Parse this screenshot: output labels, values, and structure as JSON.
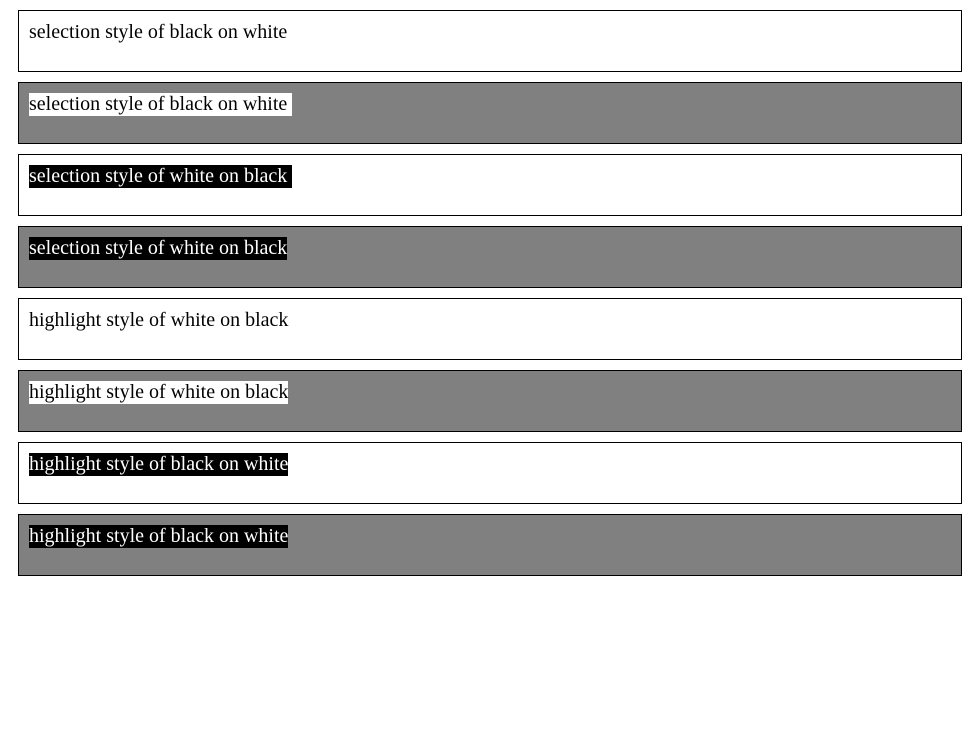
{
  "rows": [
    {
      "text": "selection style of black on white",
      "box_bg": "#ffffff",
      "text_color": "#000000",
      "highlight_bg": "none"
    },
    {
      "text": "selection style of black on white ",
      "box_bg": "#808080",
      "text_color": "#000000",
      "highlight_bg": "#ffffff"
    },
    {
      "text": "selection style of white on black ",
      "box_bg": "#ffffff",
      "text_color": "#ffffff",
      "highlight_bg": "#000000"
    },
    {
      "text": "selection style of white on black",
      "box_bg": "#808080",
      "text_color": "#ffffff",
      "highlight_bg": "#000000"
    },
    {
      "text": "highlight style of white on black",
      "box_bg": "#ffffff",
      "text_color": "#000000",
      "highlight_bg": "none"
    },
    {
      "text": "highlight style of white on black",
      "box_bg": "#808080",
      "text_color": "#000000",
      "highlight_bg": "#ffffff"
    },
    {
      "text": "highlight style of black on white",
      "box_bg": "#ffffff",
      "text_color": "#ffffff",
      "highlight_bg": "#000000"
    },
    {
      "text": "highlight style of black on white",
      "box_bg": "#808080",
      "text_color": "#ffffff",
      "highlight_bg": "#000000"
    }
  ]
}
